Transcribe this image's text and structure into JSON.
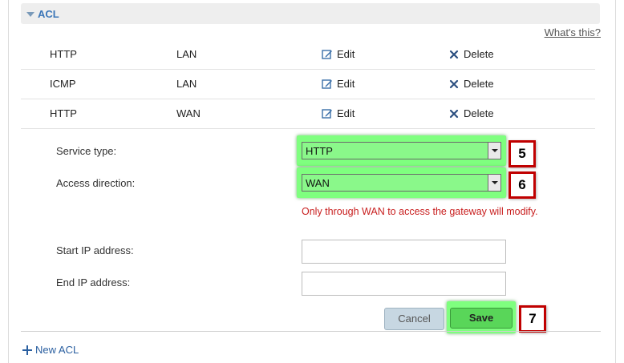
{
  "section": {
    "title": "ACL"
  },
  "help": {
    "whats_this": "What's this?"
  },
  "rows": [
    {
      "service": "HTTP",
      "direction": "LAN",
      "edit": "Edit",
      "delete": "Delete"
    },
    {
      "service": "ICMP",
      "direction": "LAN",
      "edit": "Edit",
      "delete": "Delete"
    },
    {
      "service": "HTTP",
      "direction": "WAN",
      "edit": "Edit",
      "delete": "Delete"
    }
  ],
  "form": {
    "service_type_label": "Service type:",
    "service_type_value": "HTTP",
    "access_direction_label": "Access direction:",
    "access_direction_value": "WAN",
    "warning": "Only through WAN to access the gateway will modify.",
    "start_ip_label": "Start IP address:",
    "start_ip_value": "",
    "end_ip_label": "End IP address:",
    "end_ip_value": "",
    "cancel_label": "Cancel",
    "save_label": "Save"
  },
  "badges": {
    "step5": "5",
    "step6": "6",
    "step7": "7"
  },
  "footer": {
    "new_acl_label": "New ACL"
  },
  "colors": {
    "accent": "#3b76b8",
    "highlight": "#7fff7f",
    "badge_border": "#c00000",
    "warning": "#c81e1e"
  },
  "icons": {
    "edit": "edit-icon",
    "delete": "close-icon",
    "add": "plus-icon"
  }
}
